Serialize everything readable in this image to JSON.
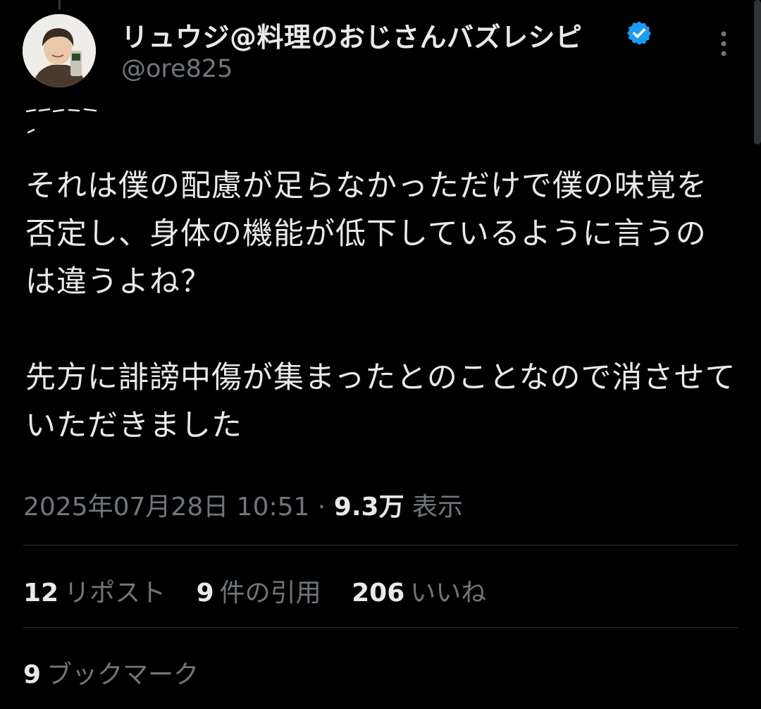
{
  "author": {
    "display_name": "リュウジ@料理のおじさんバズレシピ",
    "handle": "@ore825",
    "verified_icon": "verified-badge-icon",
    "verified_color": "#1d9bf0"
  },
  "tweet": {
    "paragraphs": [
      "それは僕の配慮が足らなかっただけで僕の味覚を否定し、身体の機能が低下しているように言うのは違うよね？",
      "先方に誹謗中傷が集まったとのことなので消させていただきました"
    ],
    "timestamp": "2025年07月28日 10:51",
    "separator": "·",
    "views_count": "9.3万",
    "views_label": "表示"
  },
  "stats": {
    "reposts_count": "12",
    "reposts_label": "リポスト",
    "quotes_count": "9",
    "quotes_label": "件の引用",
    "likes_count": "206",
    "likes_label": "いいね",
    "bookmarks_count": "9",
    "bookmarks_label": "ブックマーク"
  },
  "colors": {
    "background": "#000000",
    "text_primary": "#e7e9ea",
    "text_secondary": "#71767b",
    "divider": "#2f3336"
  }
}
